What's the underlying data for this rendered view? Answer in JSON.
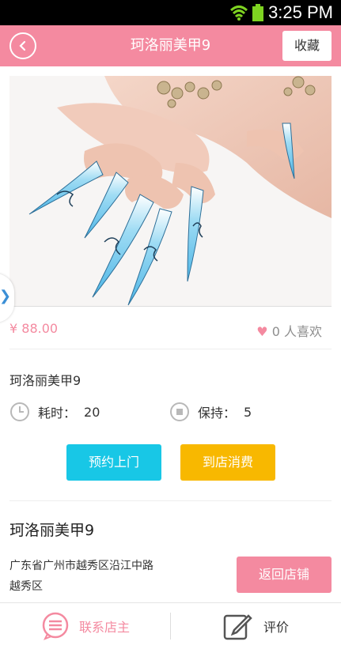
{
  "status_bar": {
    "time": "3:25 PM"
  },
  "header": {
    "title": "珂洛丽美甲9",
    "favorite_label": "收藏"
  },
  "product": {
    "price": "¥ 88.00",
    "likes": "0 人喜欢",
    "name": "珂洛丽美甲9",
    "duration_label": "耗时：",
    "duration_value": "20",
    "keep_label": "保持：",
    "keep_value": "5"
  },
  "actions": {
    "appointment_label": "预约上门",
    "in_store_label": "到店消费"
  },
  "shop": {
    "name": "珂洛丽美甲9",
    "address_line1": "广东省广州市越秀区沿江中路",
    "address_line2": "越秀区",
    "return_label": "返回店铺"
  },
  "bottom_bar": {
    "contact_label": "联系店主",
    "review_label": "评价"
  },
  "colors": {
    "brand_pink": "#f48aa0",
    "cyan": "#18c7e6",
    "amber": "#f8b800"
  },
  "icons": [
    "wifi-icon",
    "battery-icon",
    "back-icon",
    "heart-icon",
    "clock-icon",
    "stop-icon",
    "chevron-right-icon",
    "message-icon",
    "edit-icon"
  ]
}
